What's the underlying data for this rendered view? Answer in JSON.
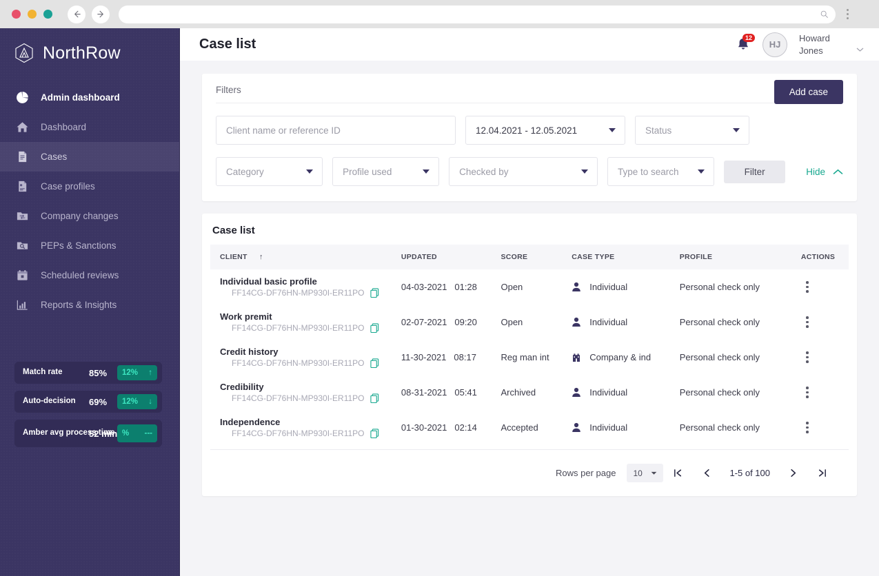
{
  "browser": {
    "traffic_lights": [
      "close-red",
      "minimize-yellow",
      "maximize-green"
    ],
    "back_icon": "back-arrow-icon",
    "forward_icon": "forward-arrow-icon",
    "url_value": "",
    "url_search_icon": "search-icon",
    "menu_icon": "browser-menu-icon"
  },
  "sidebar": {
    "brand": "NorthRow",
    "logo_icon": "northrow-hexagon-logo",
    "items": [
      {
        "label": "Admin dashboard",
        "icon": "pie-chart-icon",
        "state": "bold"
      },
      {
        "label": "Dashboard",
        "icon": "home-icon",
        "state": "normal"
      },
      {
        "label": "Cases",
        "icon": "document-icon",
        "state": "active"
      },
      {
        "label": "Case profiles",
        "icon": "document-profile-icon",
        "state": "normal"
      },
      {
        "label": "Company changes",
        "icon": "folder-swap-icon",
        "state": "normal"
      },
      {
        "label": "PEPs & Sanctions",
        "icon": "folder-search-icon",
        "state": "normal"
      },
      {
        "label": "Scheduled reviews",
        "icon": "calendar-icon",
        "state": "normal"
      },
      {
        "label": "Reports & Insights",
        "icon": "bar-chart-icon",
        "state": "normal"
      }
    ],
    "stats": [
      {
        "label": "Match rate",
        "value": "85%",
        "delta": "12%",
        "trend": "up"
      },
      {
        "label": "Auto-decision",
        "value": "69%",
        "delta": "12%",
        "trend": "down"
      },
      {
        "label": "Amber avg process time",
        "value": "52 min",
        "delta": "%",
        "trend": "flat"
      }
    ]
  },
  "header": {
    "title": "Case list",
    "bell_icon": "notification-bell-icon",
    "notification_count": "12",
    "avatar_initials": "HJ",
    "user_name": "Howard Jones",
    "chevron_icon": "chevron-down-icon"
  },
  "filters": {
    "label": "Filters",
    "add_case_label": "Add case",
    "search_placeholder": "Client name or reference ID",
    "date_range_value": "12.04.2021 - 12.05.2021",
    "status_placeholder": "Status",
    "category_placeholder": "Category",
    "profile_used_placeholder": "Profile used",
    "checked_by_placeholder": "Checked by",
    "type_to_search_placeholder": "Type to search",
    "filter_button_label": "Filter",
    "hide_label": "Hide",
    "hide_chevron_icon": "chevron-up-icon"
  },
  "case_list": {
    "title": "Case list",
    "columns": [
      "CLIENT",
      "UPDATED",
      "SCORE",
      "CASE TYPE",
      "PROFILE",
      "ACTIONS"
    ],
    "sort_column": "CLIENT",
    "sort_direction_icon": "sort-ascending-arrow",
    "copy_icon": "copy-icon",
    "row_menu_icon": "kebab-menu-icon",
    "rows": [
      {
        "client": "Individual basic profile",
        "reference": "FF14CG-DF76HN-MP930I-ER11PO",
        "date": "04-03-2021",
        "time": "01:28",
        "score": "Open",
        "case_type": "Individual",
        "case_type_icon": "person-icon",
        "profile": "Personal check only"
      },
      {
        "client": "Work premit",
        "reference": "FF14CG-DF76HN-MP930I-ER11PO",
        "date": "02-07-2021",
        "time": "09:20",
        "score": "Open",
        "case_type": "Individual",
        "case_type_icon": "person-icon",
        "profile": "Personal check only"
      },
      {
        "client": "Credit history",
        "reference": "FF14CG-DF76HN-MP930I-ER11PO",
        "date": "11-30-2021",
        "time": "08:17",
        "score": "Reg man int",
        "case_type": "Company & ind",
        "case_type_icon": "building-icon",
        "profile": "Personal check only"
      },
      {
        "client": "Credibility",
        "reference": "FF14CG-DF76HN-MP930I-ER11PO",
        "date": "08-31-2021",
        "time": "05:41",
        "score": "Archived",
        "case_type": "Individual",
        "case_type_icon": "person-icon",
        "profile": "Personal check only"
      },
      {
        "client": "Independence",
        "reference": "FF14CG-DF76HN-MP930I-ER11PO",
        "date": "01-30-2021",
        "time": "02:14",
        "score": "Accepted",
        "case_type": "Individual",
        "case_type_icon": "person-icon",
        "profile": "Personal check only"
      }
    ],
    "pagination": {
      "rows_per_page_label": "Rows per page",
      "rows_per_page_value": "10",
      "range_label": "1-5 of 100",
      "first_icon": "first-page-icon",
      "prev_icon": "previous-page-icon",
      "next_icon": "next-page-icon",
      "last_icon": "last-page-icon"
    }
  },
  "colors": {
    "sidebar_bg": "#3b3563",
    "accent_teal": "#17a88f",
    "badge_red": "#e02020",
    "page_bg": "#f4f4f7",
    "stat_badge_bg": "#0c7f6e"
  }
}
